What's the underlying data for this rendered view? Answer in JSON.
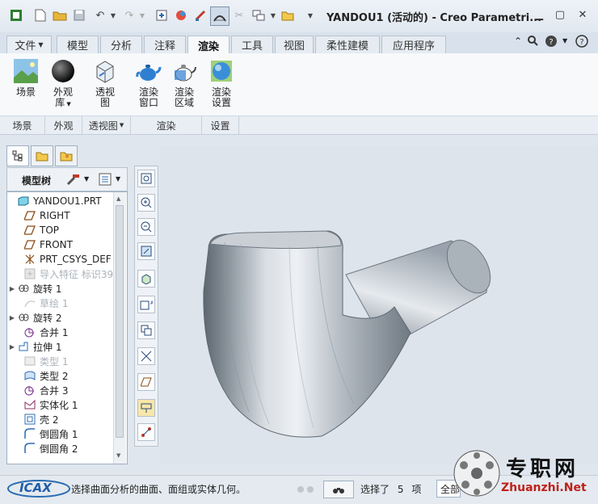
{
  "window": {
    "title": "YANDOU1 (活动的) - Creo Parametri..."
  },
  "ribbon_tabs": [
    {
      "label": "文件"
    },
    {
      "label": "模型"
    },
    {
      "label": "分析"
    },
    {
      "label": "注释"
    },
    {
      "label": "渲染"
    },
    {
      "label": "工具"
    },
    {
      "label": "视图"
    },
    {
      "label": "柔性建模"
    },
    {
      "label": "应用程序"
    }
  ],
  "ribbon_buttons": {
    "scene": "场景",
    "appearance_1": "外观",
    "appearance_2": "库",
    "perspective_1": "透视",
    "perspective_2": "图",
    "render_window_1": "渲染",
    "render_window_2": "窗口",
    "render_region_1": "渲染",
    "render_region_2": "区域",
    "render_setup_1": "渲染",
    "render_setup_2": "设置"
  },
  "ribbon_groups": [
    "场景",
    "外观",
    "透视图",
    "渲染",
    "设置"
  ],
  "model_tree": {
    "header": "模型树",
    "items": [
      {
        "label": "YANDOU1.PRT",
        "icon": "part-icon",
        "expand": false,
        "dim": false
      },
      {
        "label": "RIGHT",
        "icon": "datum-plane-icon",
        "expand": false,
        "dim": false
      },
      {
        "label": "TOP",
        "icon": "datum-plane-icon",
        "expand": false,
        "dim": false
      },
      {
        "label": "FRONT",
        "icon": "datum-plane-icon",
        "expand": false,
        "dim": false
      },
      {
        "label": "PRT_CSYS_DEF",
        "icon": "csys-icon",
        "expand": false,
        "dim": false
      },
      {
        "label": "导入特征 标识39",
        "icon": "import-icon",
        "expand": false,
        "dim": true
      },
      {
        "label": "旋转 1",
        "icon": "revolve-icon",
        "expand": true,
        "dim": false
      },
      {
        "label": "草绘 1",
        "icon": "sketch-icon",
        "expand": false,
        "dim": true
      },
      {
        "label": "旋转 2",
        "icon": "revolve-icon",
        "expand": true,
        "dim": false
      },
      {
        "label": "合并 1",
        "icon": "merge-icon",
        "expand": false,
        "dim": false
      },
      {
        "label": "拉伸 1",
        "icon": "extrude-icon",
        "expand": true,
        "dim": false
      },
      {
        "label": "类型 1",
        "icon": "style-icon",
        "expand": false,
        "dim": true
      },
      {
        "label": "类型 2",
        "icon": "style-icon",
        "expand": false,
        "dim": false
      },
      {
        "label": "合并 3",
        "icon": "merge-icon",
        "expand": false,
        "dim": false
      },
      {
        "label": "实体化 1",
        "icon": "solidify-icon",
        "expand": false,
        "dim": false
      },
      {
        "label": "壳 2",
        "icon": "shell-icon",
        "expand": false,
        "dim": false
      },
      {
        "label": "倒圆角 1",
        "icon": "round-icon",
        "expand": false,
        "dim": false
      },
      {
        "label": "倒圆角 2",
        "icon": "round-icon",
        "expand": false,
        "dim": false
      }
    ]
  },
  "status_bar": {
    "message": "选择曲面分析的曲面、面组或实体几何。",
    "selected_prefix": "选择了",
    "selected_count": "5",
    "selected_suffix": "项",
    "filter": "全部"
  },
  "watermarks": {
    "left": "ICAX",
    "right_cn": "专职网",
    "right_en": "Zhuanzhi.Net"
  },
  "colors": {
    "accent": "#3a6ea5",
    "model_gray": "#9aa3ad"
  }
}
